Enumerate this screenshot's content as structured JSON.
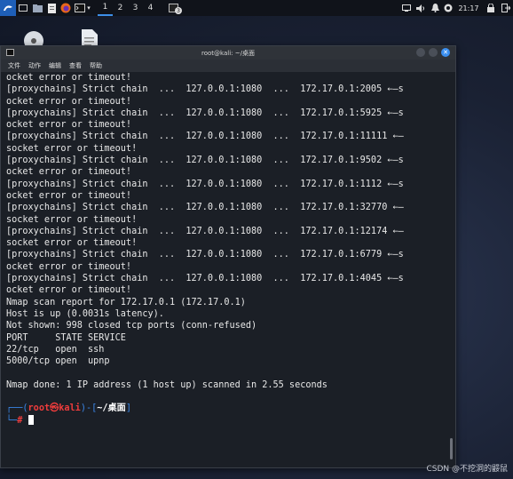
{
  "panel": {
    "workspaces": [
      "1",
      "2",
      "3",
      "4"
    ],
    "active_workspace": "1",
    "task_badge": "3",
    "clock": "21:17",
    "icons": [
      "kali-menu-icon",
      "show-desktop-icon",
      "file-manager-icon",
      "text-editor-icon",
      "firefox-icon",
      "terminal-icon",
      "notification-icon",
      "volume-icon",
      "bell-icon",
      "power-icon",
      "lock-icon",
      "logout-icon"
    ]
  },
  "window": {
    "title": "root@kali: ~/桌面",
    "menu": [
      "文件",
      "动作",
      "编辑",
      "查看",
      "帮助"
    ]
  },
  "terminal": {
    "lines": [
      "ocket error or timeout!",
      "[proxychains] Strict chain  ...  127.0.0.1:1080  ...  172.17.0.1:2005 ←—s",
      "ocket error or timeout!",
      "[proxychains] Strict chain  ...  127.0.0.1:1080  ...  172.17.0.1:5925 ←—s",
      "ocket error or timeout!",
      "[proxychains] Strict chain  ...  127.0.0.1:1080  ...  172.17.0.1:11111 ←—",
      "socket error or timeout!",
      "[proxychains] Strict chain  ...  127.0.0.1:1080  ...  172.17.0.1:9502 ←—s",
      "ocket error or timeout!",
      "[proxychains] Strict chain  ...  127.0.0.1:1080  ...  172.17.0.1:1112 ←—s",
      "ocket error or timeout!",
      "[proxychains] Strict chain  ...  127.0.0.1:1080  ...  172.17.0.1:32770 ←—",
      "socket error or timeout!",
      "[proxychains] Strict chain  ...  127.0.0.1:1080  ...  172.17.0.1:12174 ←—",
      "socket error or timeout!",
      "[proxychains] Strict chain  ...  127.0.0.1:1080  ...  172.17.0.1:6779 ←—s",
      "ocket error or timeout!",
      "[proxychains] Strict chain  ...  127.0.0.1:1080  ...  172.17.0.1:4045 ←—s",
      "ocket error or timeout!",
      "Nmap scan report for 172.17.0.1 (172.17.0.1)",
      "Host is up (0.0031s latency).",
      "Not shown: 998 closed tcp ports (conn-refused)",
      "PORT     STATE SERVICE",
      "22/tcp   open  ssh",
      "5000/tcp open  upnp",
      "",
      "Nmap done: 1 IP address (1 host up) scanned in 2.55 seconds",
      ""
    ],
    "prompt": {
      "open": "┌──(",
      "user": "root㉿kali",
      "mid": ")-[",
      "path": "~/桌面",
      "close": "]",
      "second_prefix": "└─",
      "hash": "#"
    }
  },
  "watermark": "CSDN @不挖洞的鼹鼠"
}
